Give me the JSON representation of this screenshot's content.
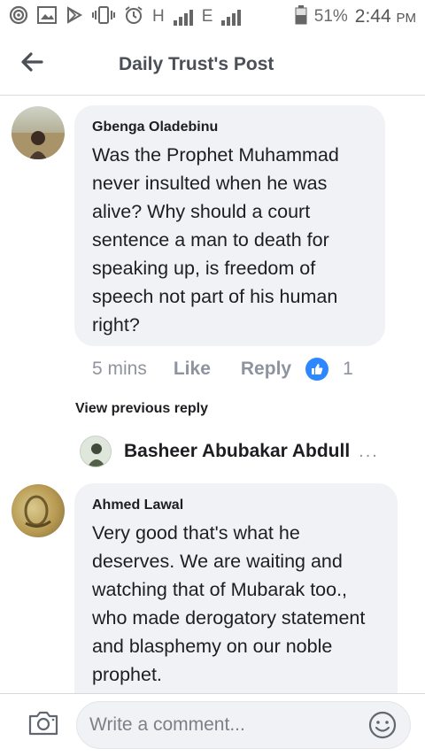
{
  "status_bar": {
    "network_label": "H",
    "network_label_2": "E",
    "battery_percent": "51%",
    "time": "2:44",
    "ampm": "PM"
  },
  "header": {
    "title": "Daily Trust's Post",
    "back_icon": "arrow-left-icon"
  },
  "comments": [
    {
      "author": "Gbenga Oladebinu",
      "text": "Was the Prophet Muhammad never insulted when he was alive?  Why should a court sentence a man to death for speaking up,  is freedom of speech not part of his human right?",
      "time": "5 mins",
      "like_label": "Like",
      "reply_label": "Reply",
      "like_count": "1"
    },
    {
      "author": "Ahmed Lawal",
      "text": "Very good that's what he deserves. We are waiting and watching that of Mubarak too., who made derogatory statement and blasphemy on our noble prophet."
    }
  ],
  "view_previous_reply": "View previous reply",
  "reply_preview": {
    "name": "Basheer Abubakar Abdull",
    "more": "..."
  },
  "composer": {
    "placeholder": "Write a comment...",
    "camera_icon": "camera-icon",
    "emoji_icon": "smiley-icon"
  },
  "colors": {
    "like_blue": "#2d88ff",
    "bubble_bg": "#f0f2f5",
    "muted_text": "#8d949e"
  }
}
